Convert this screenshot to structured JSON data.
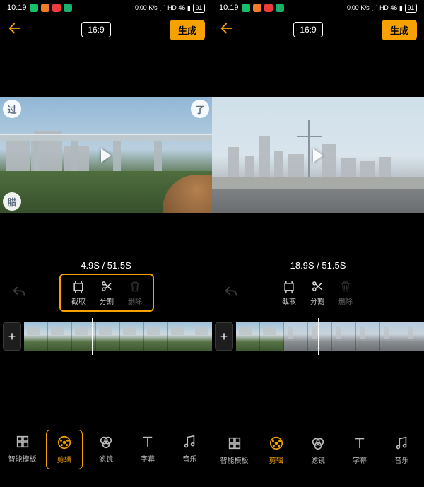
{
  "status": {
    "time": "10:19",
    "net_top": "0.00",
    "net_unit": "K/s",
    "hd": "HD",
    "sig": "46",
    "battery": "91"
  },
  "topbar": {
    "ratio": "16:9",
    "generate": "生成"
  },
  "preview": {
    "left": {
      "badge_tl": "过",
      "badge_tr": "了",
      "badge_bl": "腊"
    }
  },
  "time_left": "4.9S / 51.5S",
  "time_right": "18.9S / 51.5S",
  "edit_tools": {
    "crop": "截取",
    "split": "分割",
    "delete": "删除"
  },
  "tabs": {
    "template": "智能模板",
    "edit": "剪辑",
    "filter": "滤镜",
    "subtitle": "字幕",
    "music": "音乐"
  },
  "add_label": "+"
}
